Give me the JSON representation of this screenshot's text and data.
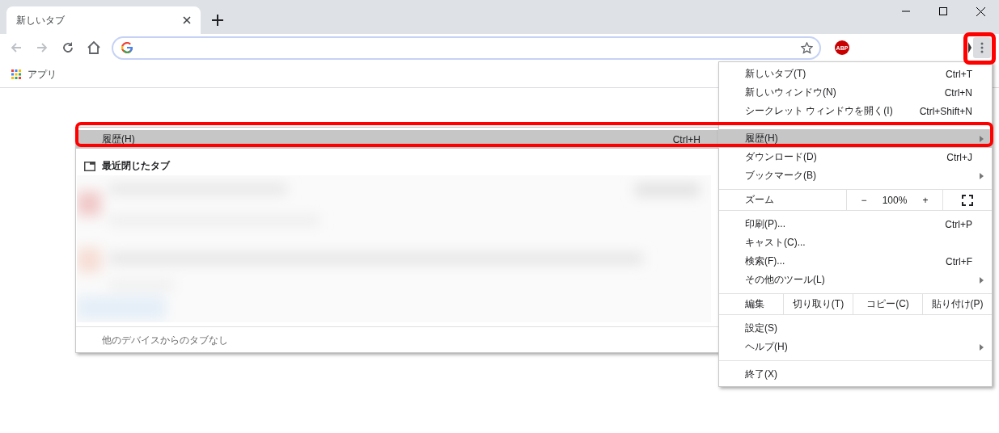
{
  "tab": {
    "title": "新しいタブ",
    "selected": true
  },
  "nav": [
    {
      "kind": "back",
      "disabled": true
    },
    {
      "kind": "forward",
      "disabled": true
    },
    {
      "kind": "reload",
      "disabled": false
    },
    {
      "kind": "home",
      "disabled": false
    }
  ],
  "omnibox": {
    "focused": true
  },
  "extension_badge": "ABP",
  "menu_button": {
    "pressed": true
  },
  "bookmarks": [
    {
      "label": "アプリ"
    }
  ],
  "menu": {
    "items": [
      {
        "kind": "item",
        "label": "新しいタブ(T)",
        "shortcut": "Ctrl+T",
        "submenu": false,
        "selected": false
      },
      {
        "kind": "item",
        "label": "新しいウィンドウ(N)",
        "shortcut": "Ctrl+N",
        "submenu": false,
        "selected": false
      },
      {
        "kind": "item",
        "label": "シークレット ウィンドウを開く(I)",
        "shortcut": "Ctrl+Shift+N",
        "submenu": false,
        "selected": false
      },
      {
        "kind": "separator"
      },
      {
        "kind": "item",
        "label": "履歴(H)",
        "submenu": true,
        "selected": true
      },
      {
        "kind": "item",
        "label": "ダウンロード(D)",
        "shortcut": "Ctrl+J",
        "submenu": false,
        "selected": false
      },
      {
        "kind": "item",
        "label": "ブックマーク(B)",
        "submenu": true,
        "selected": false
      },
      {
        "kind": "zoom",
        "label": "ズーム",
        "minus": "−",
        "value": "100%",
        "plus": "+"
      },
      {
        "kind": "item",
        "label": "印刷(P)...",
        "shortcut": "Ctrl+P",
        "submenu": false,
        "selected": false
      },
      {
        "kind": "item",
        "label": "キャスト(C)...",
        "submenu": false,
        "selected": false
      },
      {
        "kind": "item",
        "label": "検索(F)...",
        "shortcut": "Ctrl+F",
        "submenu": false,
        "selected": false
      },
      {
        "kind": "item",
        "label": "その他のツール(L)",
        "submenu": true,
        "selected": false
      },
      {
        "kind": "edit",
        "label": "編集",
        "actions": [
          "切り取り(T)",
          "コピー(C)",
          "貼り付け(P)"
        ]
      },
      {
        "kind": "item",
        "label": "設定(S)",
        "submenu": false,
        "selected": false
      },
      {
        "kind": "item",
        "label": "ヘルプ(H)",
        "submenu": true,
        "selected": false
      },
      {
        "kind": "separator"
      },
      {
        "kind": "item",
        "label": "終了(X)",
        "submenu": false,
        "selected": false
      }
    ]
  },
  "submenu": {
    "items": [
      {
        "kind": "item",
        "label": "履歴(H)",
        "shortcut": "Ctrl+H",
        "selected": true
      },
      {
        "kind": "header",
        "label": "最近閉じたタブ"
      },
      {
        "kind": "picture"
      },
      {
        "kind": "separator"
      },
      {
        "kind": "note",
        "label": "他のデバイスからのタブなし"
      }
    ]
  },
  "annotations": {
    "menu_button_highlighted": true,
    "history_row_highlighted": true
  }
}
